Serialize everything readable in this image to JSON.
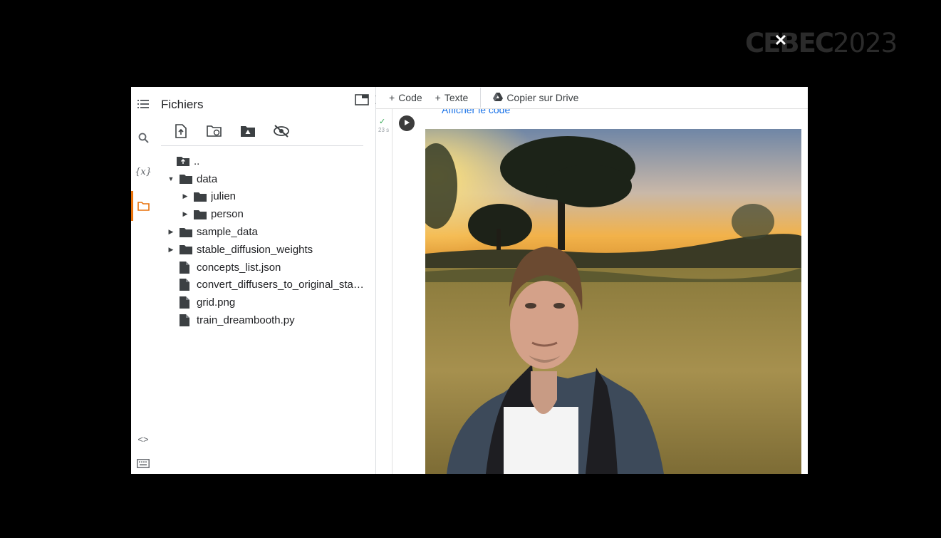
{
  "watermark": {
    "part1": "CEBEC",
    "part2": "2023",
    "close_glyph": "✕"
  },
  "rail": {
    "icons": [
      "menu-icon",
      "search-icon",
      "variables-icon",
      "folder-icon",
      "code-snippets-icon",
      "terminal-icon"
    ],
    "variables_label": "{x}",
    "snippets_label": "<>"
  },
  "files_panel": {
    "title": "Fichiers",
    "tools": [
      "upload-icon",
      "refresh-icon",
      "mount-drive-icon",
      "hide-icon"
    ],
    "tree": [
      {
        "name": "..",
        "type": "parent",
        "indent": 0
      },
      {
        "name": "data",
        "type": "folder",
        "expanded": true,
        "indent": 0
      },
      {
        "name": "julien",
        "type": "folder",
        "expanded": false,
        "indent": 1
      },
      {
        "name": "person",
        "type": "folder",
        "expanded": false,
        "indent": 1
      },
      {
        "name": "sample_data",
        "type": "folder",
        "expanded": false,
        "indent": 0
      },
      {
        "name": "stable_diffusion_weights",
        "type": "folder",
        "expanded": false,
        "indent": 0
      },
      {
        "name": "concepts_list.json",
        "type": "file",
        "indent": 0
      },
      {
        "name": "convert_diffusers_to_original_stabl...",
        "type": "file",
        "indent": 0
      },
      {
        "name": "grid.png",
        "type": "file",
        "indent": 0
      },
      {
        "name": "train_dreambooth.py",
        "type": "file",
        "indent": 0
      }
    ]
  },
  "toolbar": {
    "code_label": "Code",
    "text_label": "Texte",
    "drive_label": "Copier sur Drive",
    "plus": "+"
  },
  "cell": {
    "link_text": "Afficher le code",
    "check": "✓",
    "exec_time": "23 s"
  },
  "colors": {
    "accent": "#e8710a",
    "link": "#1a73e8",
    "check": "#34a853"
  }
}
